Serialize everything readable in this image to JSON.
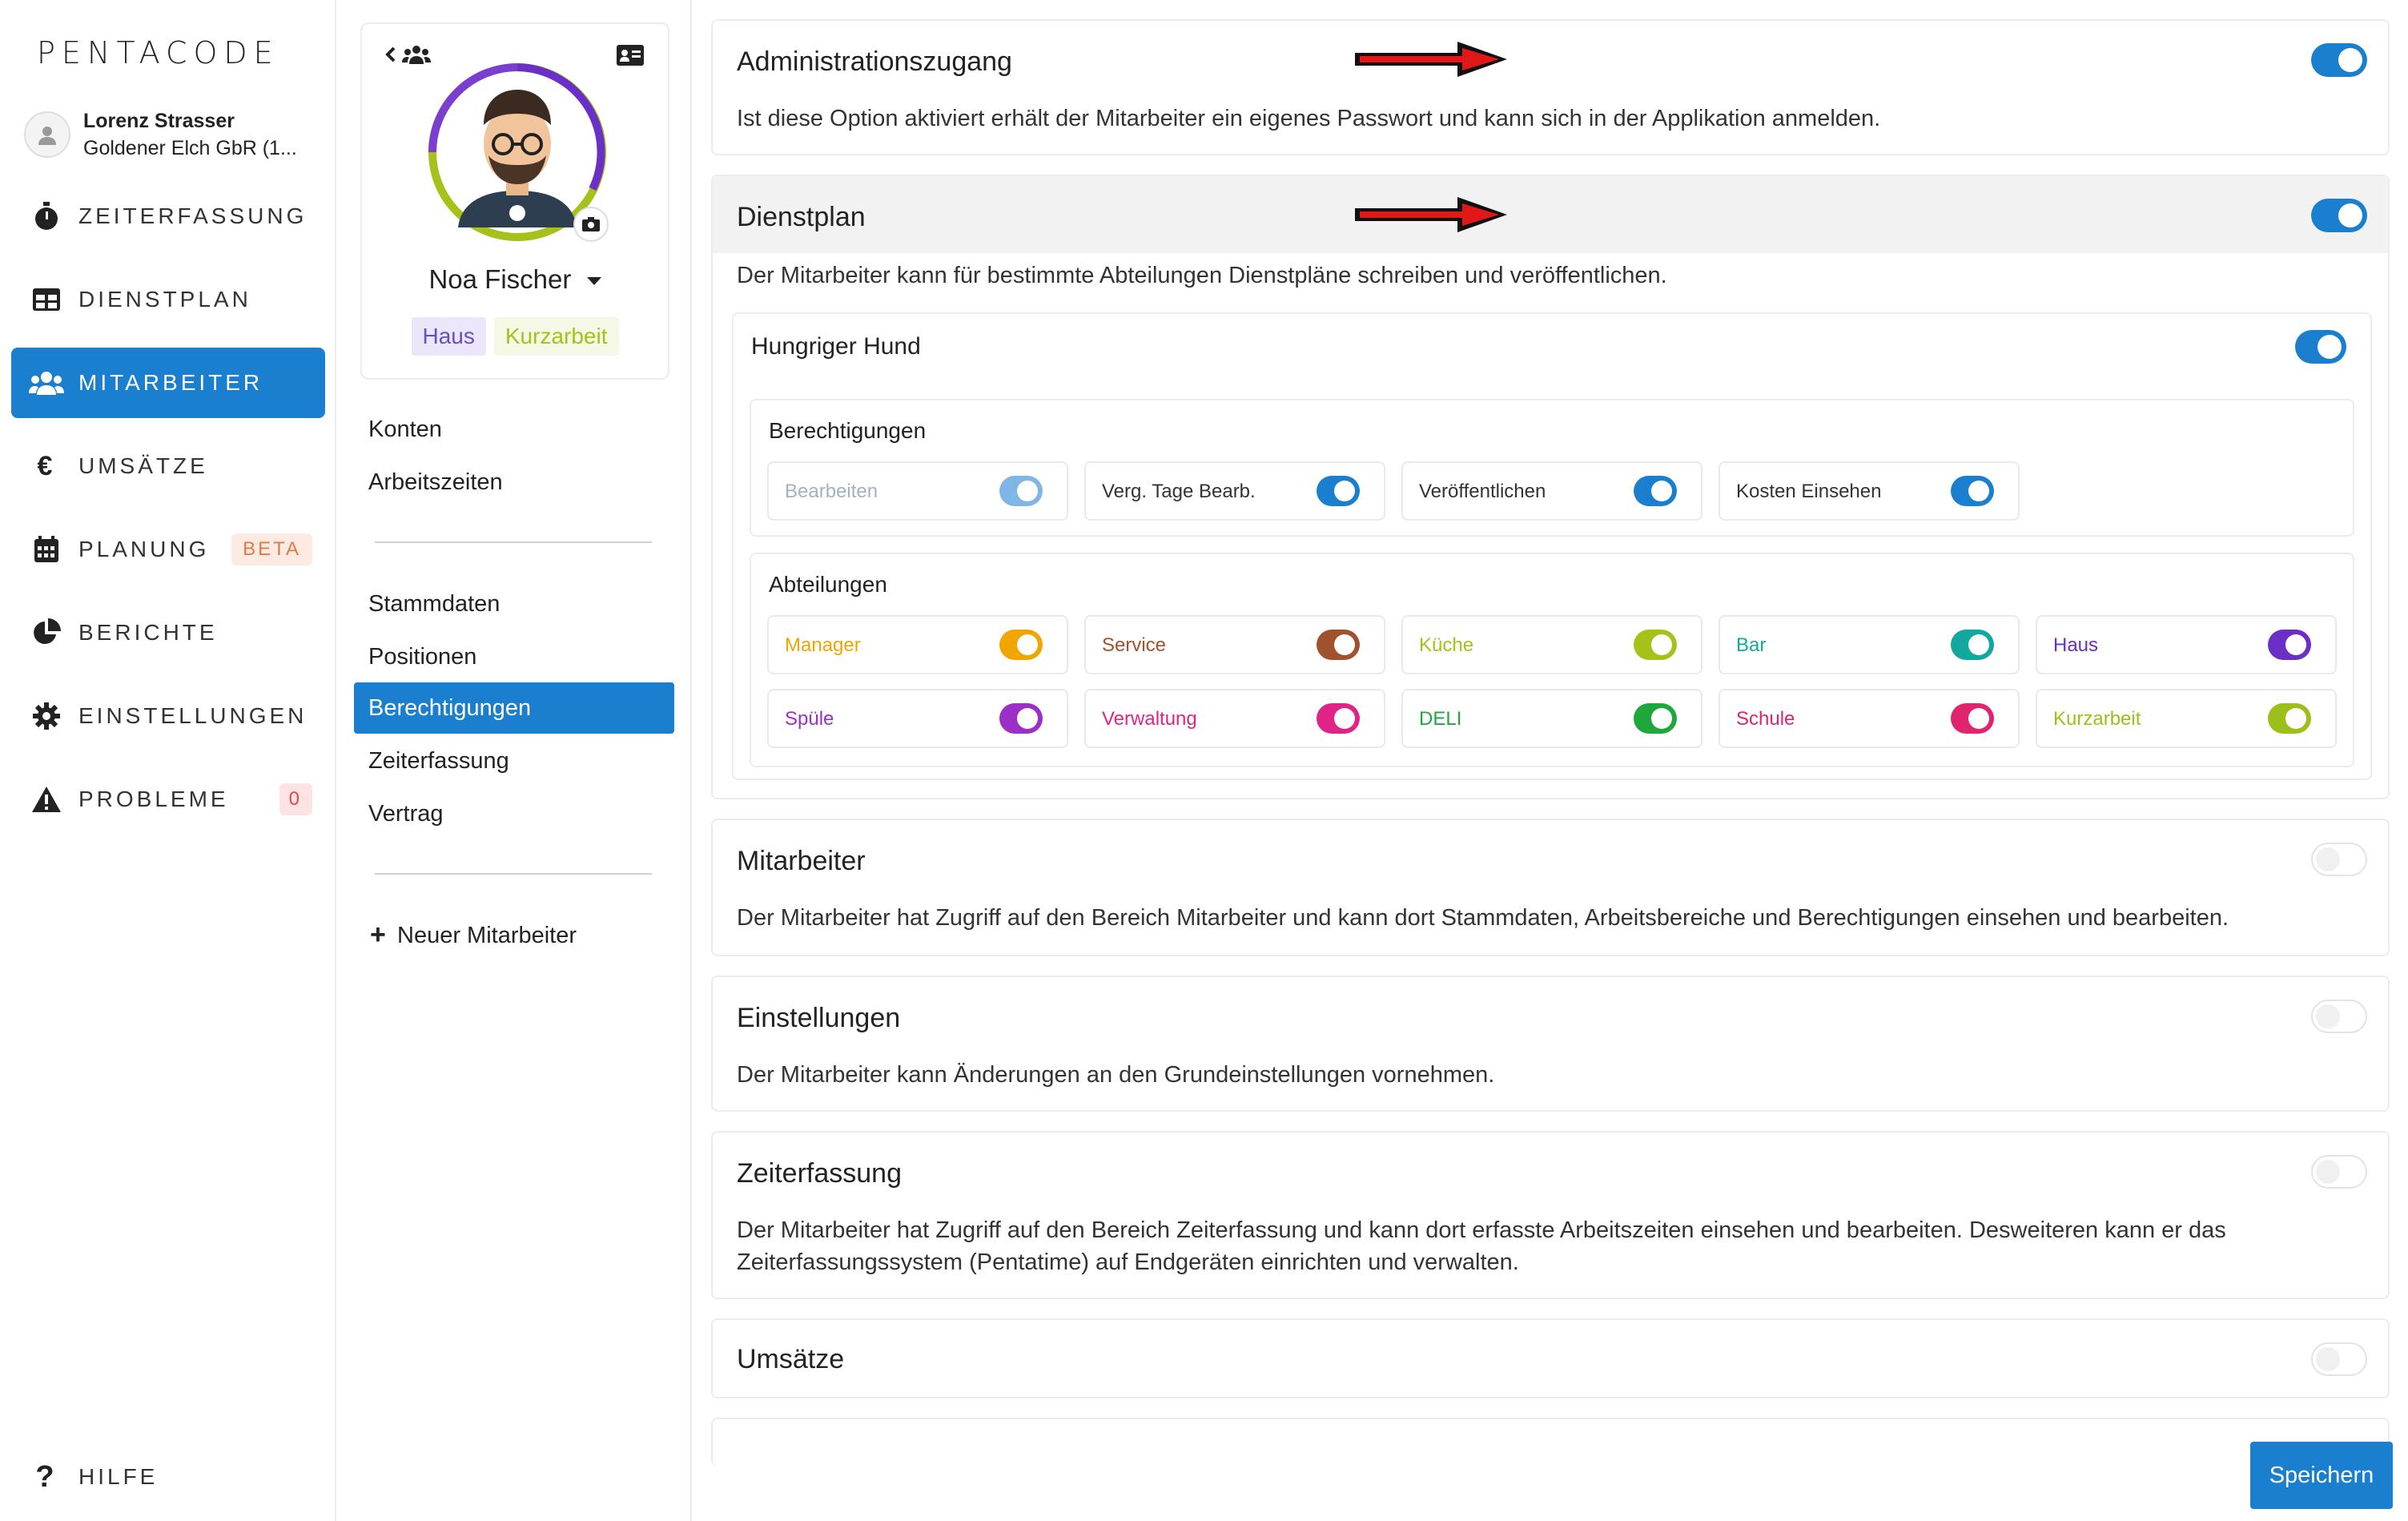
{
  "app": {
    "logo": "PENTACODE"
  },
  "user": {
    "name": "Lorenz Strasser",
    "company": "Goldener Elch GbR (1..."
  },
  "nav": [
    {
      "label": "ZEITERFASSUNG",
      "icon": "stopwatch-icon"
    },
    {
      "label": "DIENSTPLAN",
      "icon": "table-icon"
    },
    {
      "label": "MITARBEITER",
      "icon": "users-icon",
      "active": true
    },
    {
      "label": "UMSÄTZE",
      "icon": "euro-icon"
    },
    {
      "label": "PLANUNG",
      "icon": "calendar-icon",
      "badge": "BETA"
    },
    {
      "label": "BERICHTE",
      "icon": "pie-chart-icon"
    },
    {
      "label": "EINSTELLUNGEN",
      "icon": "gear-icon"
    },
    {
      "label": "PROBLEME",
      "icon": "warning-icon",
      "badge": "0"
    }
  ],
  "help": {
    "label": "HILFE"
  },
  "employee": {
    "name": "Noa Fischer",
    "tags": [
      "Haus",
      "Kurzarbeit"
    ]
  },
  "subnav": {
    "group1": [
      "Konten",
      "Arbeitszeiten"
    ],
    "group2": [
      "Stammdaten",
      "Positionen",
      "Berechtigungen",
      "Zeiterfassung",
      "Vertrag"
    ],
    "new_label": "Neuer Mitarbeiter"
  },
  "panels": {
    "admin": {
      "title": "Administrationszugang",
      "desc": "Ist diese Option aktiviert erhält der Mitarbeiter ein eigenes Passwort und kann sich in der Applikation anmelden.",
      "on": true
    },
    "dienstplan": {
      "title": "Dienstplan",
      "desc": "Der Mitarbeiter kann für bestimmte Abteilungen Dienstpläne schreiben und veröffentlichen.",
      "on": true
    },
    "mitarbeiter": {
      "title": "Mitarbeiter",
      "desc": "Der Mitarbeiter hat Zugriff auf den Bereich Mitarbeiter und kann dort Stammdaten, Arbeitsbereiche und Berechtigungen einsehen und bearbeiten.",
      "on": false
    },
    "einstellungen": {
      "title": "Einstellungen",
      "desc": "Der Mitarbeiter kann Änderungen an den Grundeinstellungen vornehmen.",
      "on": false
    },
    "zeiterfassung": {
      "title": "Zeiterfassung",
      "desc": "Der Mitarbeiter hat Zugriff auf den Bereich Zeiterfassung und kann dort erfasste Arbeitszeiten einsehen und bearbeiten. Desweiteren kann er das Zeiterfassungssystem (Pentatime) auf Endgeräten einrichten und verwalten.",
      "on": false
    },
    "umsaetze": {
      "title": "Umsätze",
      "on": false
    }
  },
  "location": {
    "name": "Hungriger Hund",
    "on": true,
    "perm_title": "Berechtigungen",
    "permissions": [
      {
        "label": "Bearbeiten",
        "color": "#9fb2c4",
        "toggle": "#7fb6e6"
      },
      {
        "label": "Verg. Tage Bearb.",
        "color": "#333333",
        "toggle": "#1b7fd0"
      },
      {
        "label": "Veröffentlichen",
        "color": "#333333",
        "toggle": "#1b7fd0"
      },
      {
        "label": "Kosten Einsehen",
        "color": "#333333",
        "toggle": "#1b7fd0"
      }
    ],
    "dept_title": "Abteilungen",
    "departments": [
      {
        "label": "Manager",
        "color": "#f0a500"
      },
      {
        "label": "Service",
        "color": "#a0522d"
      },
      {
        "label": "Küche",
        "color": "#a6c21a"
      },
      {
        "label": "Bar",
        "color": "#12a8a0"
      },
      {
        "label": "Haus",
        "color": "#6a2fc6"
      },
      {
        "label": "Spüle",
        "color": "#9b2fc8"
      },
      {
        "label": "Verwaltung",
        "color": "#e02487"
      },
      {
        "label": "DELI",
        "color": "#1ea83c"
      },
      {
        "label": "Schule",
        "color": "#e0246e"
      },
      {
        "label": "Kurzarbeit",
        "color": "#9cbf1a"
      }
    ]
  },
  "save_label": "Speichern"
}
